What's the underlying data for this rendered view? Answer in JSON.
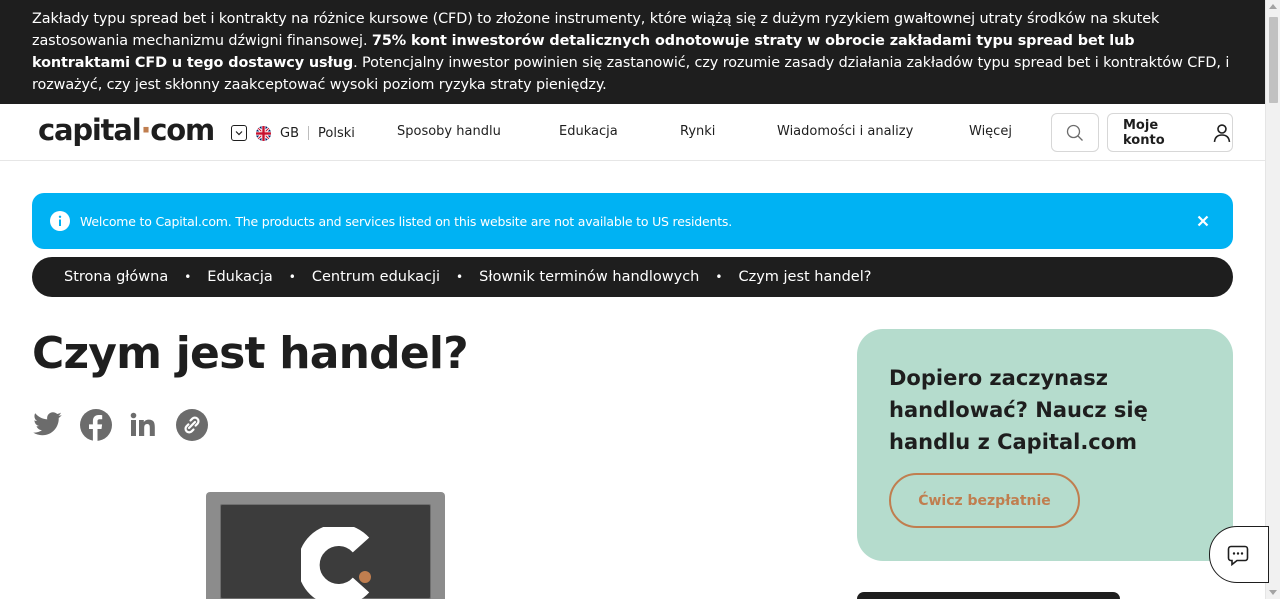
{
  "risk_banner": {
    "text_before": "Zakłady typu spread bet i kontrakty na różnice kursowe (CFD) to złożone instrumenty, które wiążą się z dużym ryzykiem gwałtownej utraty środków na skutek zastosowania mechanizmu dźwigni finansowej. ",
    "text_bold": "75% kont inwestorów detalicznych odnotowuje straty w obrocie zakładami typu spread bet lub kontraktami CFD u tego dostawcy usług",
    "text_after": ". Potencjalny inwestor powinien się zastanowić, czy rozumie zasady działania zakładów typu spread bet i kontraktów CFD, i rozważyć, czy jest skłonny zaakceptować wysoki poziom ryzyka straty pieniędzy."
  },
  "header": {
    "logo_part1": "capital",
    "logo_dot": "·",
    "logo_part2": "com",
    "region_code": "GB",
    "language": "Polski",
    "nav": [
      "Sposoby handlu",
      "Edukacja",
      "Rynki",
      "Wiadomości i analizy",
      "Więcej"
    ],
    "search_icon": "search-icon",
    "account_label": "Moje konto",
    "account_icon": "user-icon"
  },
  "notice": {
    "text": "Welcome to Capital.com. The products and services listed on this website are not available to US residents.",
    "icon": "info-icon",
    "close_icon": "close-icon"
  },
  "breadcrumb": [
    "Strona główna",
    "Edukacja",
    "Centrum edukacji",
    "Słownik terminów handlowych",
    "Czym jest handel?"
  ],
  "article": {
    "title": "Czym jest handel?",
    "share_icons": [
      "twitter-icon",
      "facebook-icon",
      "linkedin-icon",
      "copy-link-icon"
    ]
  },
  "promo": {
    "title": "Dopiero zaczynasz handlować? Naucz się handlu z Capital.com",
    "button": "Ćwicz bezpłatnie"
  },
  "colors": {
    "dark": "#1e1e1e",
    "accent": "#c07e4f",
    "notice_blue": "#00b2f3",
    "promo_green": "#b5dccd",
    "icon_grey": "#6c6c6c"
  }
}
